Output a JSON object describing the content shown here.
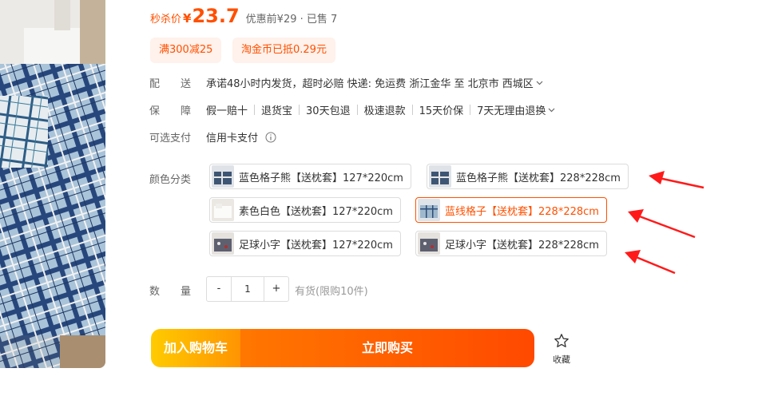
{
  "price": {
    "label": "秒杀价",
    "currency": "¥",
    "value": "23.7",
    "extra": "优惠前¥29 · 已售 7"
  },
  "promos": [
    "满300减25",
    "淘金币已抵0.29元"
  ],
  "delivery": {
    "label": "配　　送",
    "text": "承诺48小时内发货，超时必赔 快递: 免运费 浙江金华 至 北京市 西城区"
  },
  "guarantee": {
    "label": "保　　障",
    "items": [
      "假一赔十",
      "退货宝",
      "30天包退",
      "极速退款",
      "15天价保",
      "7天无理由退换"
    ]
  },
  "payment": {
    "label": "可选支付",
    "method": "信用卡支付"
  },
  "sku": {
    "label": "颜色分类",
    "options": [
      {
        "text": "蓝色格子熊【送枕套】127*220cm",
        "selected": false
      },
      {
        "text": "蓝色格子熊【送枕套】228*228cm",
        "selected": false
      },
      {
        "text": "素色白色【送枕套】127*220cm",
        "selected": false
      },
      {
        "text": "蓝线格子【送枕套】228*228cm",
        "selected": true
      },
      {
        "text": "足球小字【送枕套】127*220cm",
        "selected": false
      },
      {
        "text": "足球小字【送枕套】228*228cm",
        "selected": false
      }
    ]
  },
  "quantity": {
    "label": "数　　量",
    "minus": "-",
    "value": "1",
    "plus": "+",
    "stock": "有货(限购10件)"
  },
  "actions": {
    "cart": "加入购物车",
    "buy": "立即购买",
    "favorite": "收藏"
  },
  "colors": {
    "accent": "#ff5000",
    "annotation": "#ff1a1a"
  },
  "icons": [
    "info-icon",
    "chevron-down-icon",
    "star-icon",
    "arrow-annotation"
  ]
}
